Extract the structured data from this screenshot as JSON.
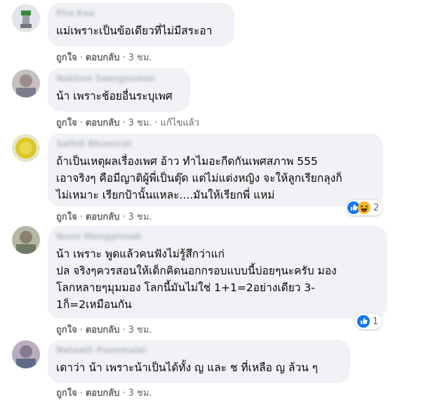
{
  "comments": [
    {
      "name": "Pha Kea",
      "text": "แม่เพราะเป็นข้อเดียวที่ไม่มีสระอา",
      "like": "ถูกใจ",
      "reply": "ตอบกลับ",
      "time": "3 ชม."
    },
    {
      "name": "Nakhon Saengsuwan",
      "text": "น้า เพราะช้อยอื่นระบุเพศ",
      "like": "ถูกใจ",
      "reply": "ตอบกลับ",
      "time": "3 ชม.",
      "edited": "แก้ไขแล้ว"
    },
    {
      "name": "Sathit Bhumirat",
      "text": "ถ้าเป็นเหตุผลเรื่องเพศ อ้าว ทำไมอะกีดกันเพศสภาพ 555\nเอาจริงๆ คือมีญาติผู้พี่เป็นตุ๊ด แต่ไม่แต่งหญิง จะให้ลูกเรียกลุงก็\nไม่เหมาะ เรียกป้านั้นแหละ....มันให้เรียกพี่ แหม่",
      "like": "ถูกใจ",
      "reply": "ตอบกลับ",
      "time": "3 ชม.",
      "reactions": {
        "count": "2",
        "icons": [
          "like-reaction-icon",
          "haha-reaction-icon"
        ]
      }
    },
    {
      "name": "Noon Wongpinsak",
      "text": "น้า เพราะ พูดแล้วคนฟังไม่รู้สึกว่าแก่\nปล จริงๆควรสอนให้เด็กคิดนอกกรอบแบบนี้บ่อยๆนะครับ มอง\nโลกหลายๆมุมมอง โลกนี้มันไม่ใช่ 1+1=2อย่างเดียว 3-\n1ก็=2เหมือนกัน",
      "like": "ถูกใจ",
      "reply": "ตอบกลับ",
      "time": "3 ชม.",
      "reactions": {
        "count": "1",
        "icons": [
          "like-reaction-icon"
        ]
      }
    },
    {
      "name": "Natawit Poonmalai",
      "text": "เดาว่า น้า เพราะน้าเป็นได้ทั้ง ญ และ ช ที่เหลือ ญ ล้วน ๆ",
      "like": "ถูกใจ",
      "reply": "ตอบกลับ",
      "time": "3 ชม."
    }
  ],
  "colors": {
    "bubble": "#f0f2f5",
    "meta": "#65676b",
    "like_blue": "#1877f2",
    "haha_yellow": "#f7b928"
  }
}
